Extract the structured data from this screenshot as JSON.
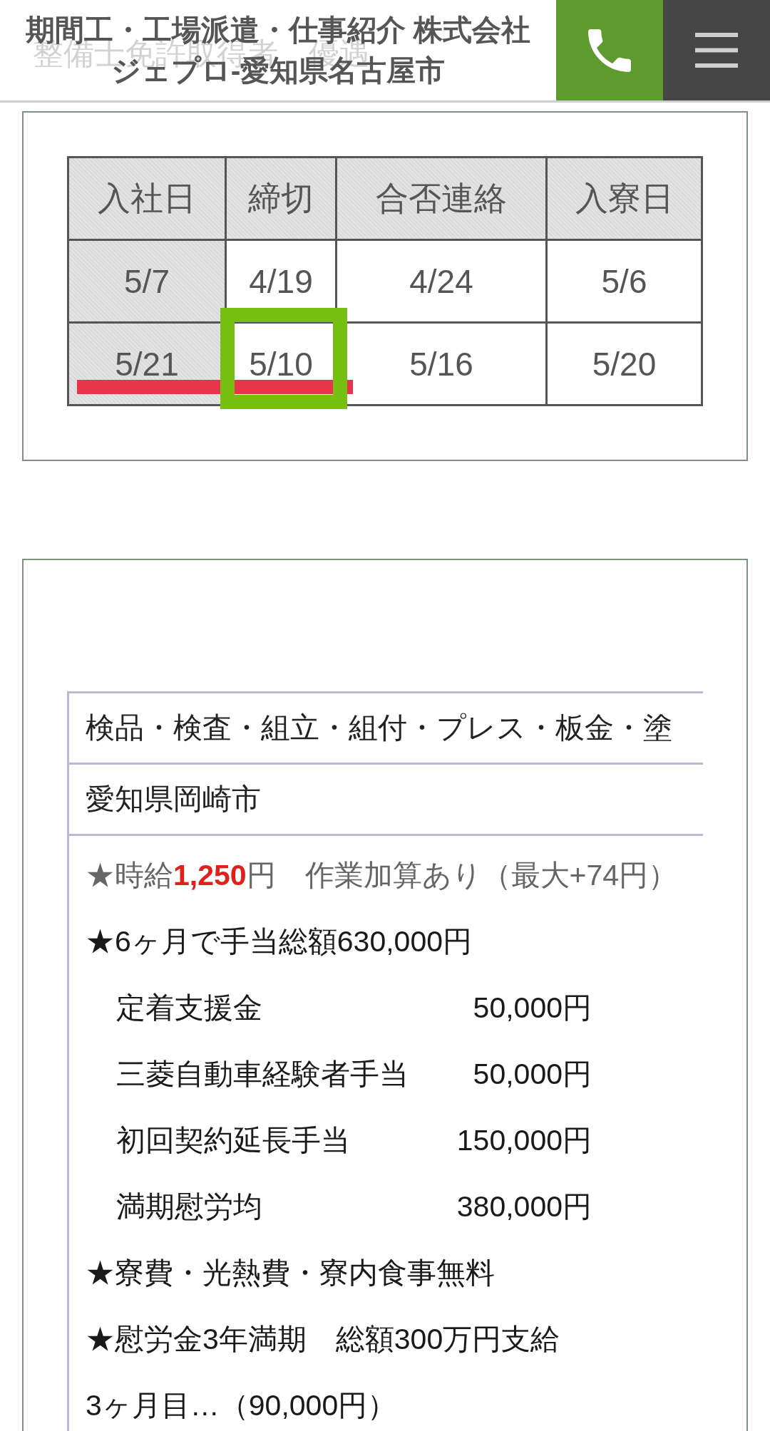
{
  "header": {
    "title_lines": [
      "期間工・工場派遣・仕事紹介 株式会社",
      "ジェプロ-愛知県名古屋市"
    ],
    "underlying_text": "整備士免許取得者　優遇"
  },
  "schedule": {
    "columns": [
      "入社日",
      "締切",
      "合否連絡",
      "入寮日"
    ],
    "rows": [
      {
        "cells": [
          {
            "text": "5/7",
            "underlined": false,
            "boxed": false
          },
          {
            "text": "4/19",
            "underlined": false,
            "boxed": false
          },
          {
            "text": "4/24",
            "underlined": false,
            "boxed": false
          },
          {
            "text": "5/6",
            "underlined": false,
            "boxed": false
          }
        ]
      },
      {
        "cells": [
          {
            "text": "5/21",
            "underlined": true,
            "boxed": false
          },
          {
            "text": "5/10",
            "underlined": true,
            "boxed": true
          },
          {
            "text": "5/16",
            "underlined": false,
            "boxed": false
          },
          {
            "text": "5/20",
            "underlined": false,
            "boxed": false
          }
        ]
      }
    ]
  },
  "job": {
    "rows": [
      "検品・検査・組立・組付・プレス・板金・塗",
      "愛知県岡崎市"
    ],
    "details": [
      {
        "kind": "wage",
        "text": "★時給**1,250**円　作業加算あり（最大+74円）"
      },
      {
        "kind": "line",
        "text": "★6ヶ月で手当総額630,000円"
      },
      {
        "kind": "allowance",
        "label": "定着支援金",
        "amount": "50,000円"
      },
      {
        "kind": "allowance",
        "label": "三菱自動車経験者手当",
        "amount": "50,000円"
      },
      {
        "kind": "allowance",
        "label": "初回契約延長手当",
        "amount": "150,000円"
      },
      {
        "kind": "allowance",
        "label": "満期慰労均",
        "amount": "380,000円"
      },
      {
        "kind": "line",
        "text": "★寮費・光熱費・寮内食事無料"
      },
      {
        "kind": "line",
        "text": "★慰労金3年満期　総額300万円支給"
      },
      {
        "kind": "line",
        "text": "3ヶ月目…（90,000円）"
      }
    ]
  }
}
